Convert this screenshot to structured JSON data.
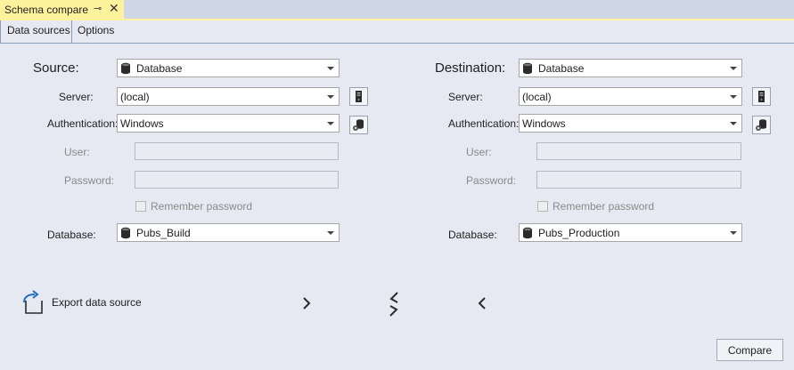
{
  "document_tab": {
    "title": "Schema compare",
    "pin_icon": "pin-icon",
    "close_icon": "close-icon"
  },
  "subtabs": {
    "data_sources": "Data sources",
    "options": "Options"
  },
  "source": {
    "heading": "Source:",
    "type": "Database",
    "server_label": "Server:",
    "server": "(local)",
    "auth_label": "Authentication:",
    "auth": "Windows",
    "user_label": "User:",
    "password_label": "Password:",
    "remember": "Remember password",
    "database_label": "Database:",
    "database": "Pubs_Build"
  },
  "destination": {
    "heading": "Destination:",
    "type": "Database",
    "server_label": "Server:",
    "server": "(local)",
    "auth_label": "Authentication:",
    "auth": "Windows",
    "user_label": "User:",
    "password_label": "Password:",
    "remember": "Remember password",
    "database_label": "Database:",
    "database": "Pubs_Production"
  },
  "footer": {
    "export_label": "Export data source",
    "compare_label": "Compare"
  }
}
